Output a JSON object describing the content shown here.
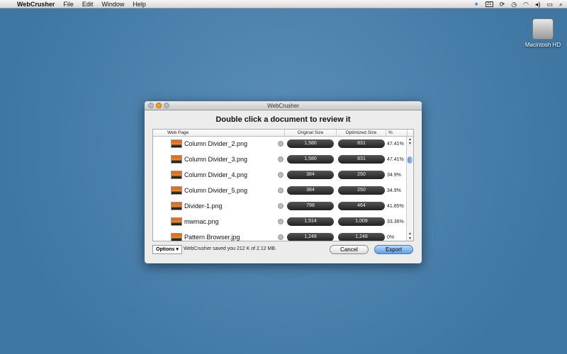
{
  "menubar": {
    "app": "WebCrusher",
    "items": [
      "File",
      "Edit",
      "Window",
      "Help"
    ],
    "calendar_day": "21"
  },
  "desktop": {
    "drive_label": "Macintosh HD"
  },
  "window": {
    "title": "WebCrusher",
    "heading": "Double click a document to review it",
    "columns": [
      "Web Page",
      "Original Size",
      "Optimized Size",
      "%"
    ],
    "rows": [
      {
        "name": "Column Divider_2.png",
        "original": "1,580",
        "optimized": "831",
        "percent": "47.41%"
      },
      {
        "name": "Column Divider_3.png",
        "original": "1,580",
        "optimized": "831",
        "percent": "47.41%"
      },
      {
        "name": "Column Divider_4.png",
        "original": "384",
        "optimized": "250",
        "percent": "34.9%"
      },
      {
        "name": "Column Divider_5.png",
        "original": "384",
        "optimized": "250",
        "percent": "34.9%"
      },
      {
        "name": "Divider-1.png",
        "original": "798",
        "optimized": "464",
        "percent": "41.85%"
      },
      {
        "name": "mwmac.png",
        "original": "1,514",
        "optimized": "1,009",
        "percent": "33.36%"
      },
      {
        "name": "Pattern Browser.jpg",
        "original": "1,248",
        "optimized": "1,248",
        "percent": "0%"
      }
    ],
    "options_label": "Options ▾",
    "status": "WebCrusher saved you 212 K of 2.12 MB.",
    "cancel": "Cancel",
    "export": "Export"
  }
}
